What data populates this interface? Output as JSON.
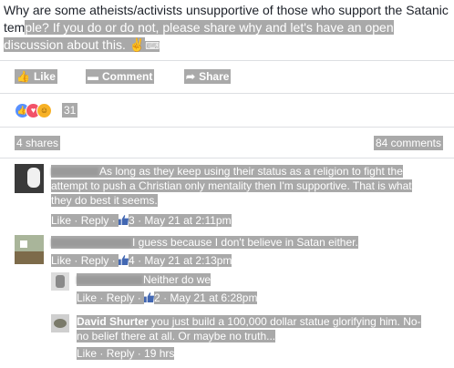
{
  "post": {
    "text_plain": "Why are some atheists/activists unsupportive of those who support the Satanic tem",
    "text_highlight": "ple? If you do or do not, please share why and let's have an open discussion about this. ✌"
  },
  "actions": {
    "like": "Like",
    "comment": "Comment",
    "share": "Share"
  },
  "reactions": {
    "count": "31"
  },
  "stats": {
    "shares": "4 shares",
    "comments": "84 comments"
  },
  "comments": [
    {
      "text": "As long as they keep using their status as a religion to fight the attempt to push a Christian only mentality then I'm supportive. That is what they do best it seems.",
      "like": "Like",
      "reply": "Reply",
      "likes": "3",
      "time": "May 21 at 2:11pm"
    },
    {
      "text": "I guess because I don't believe in Satan either.",
      "like": "Like",
      "reply": "Reply",
      "likes": "4",
      "time": "May 21 at 2:13pm"
    },
    {
      "text": "Neither do we",
      "like": "Like",
      "reply": "Reply",
      "likes": "2",
      "time": "May 21 at 6:28pm"
    },
    {
      "name": "David Shurter",
      "text": "you just build a 100,000 dollar statue glorifying him. No- no belief there at all. Or maybe no truth...",
      "like": "Like",
      "reply": "Reply",
      "time": "19 hrs"
    }
  ],
  "colors": {
    "link": "#4267b2",
    "highlight": "#a9a9a9",
    "text": "#1d2129"
  }
}
